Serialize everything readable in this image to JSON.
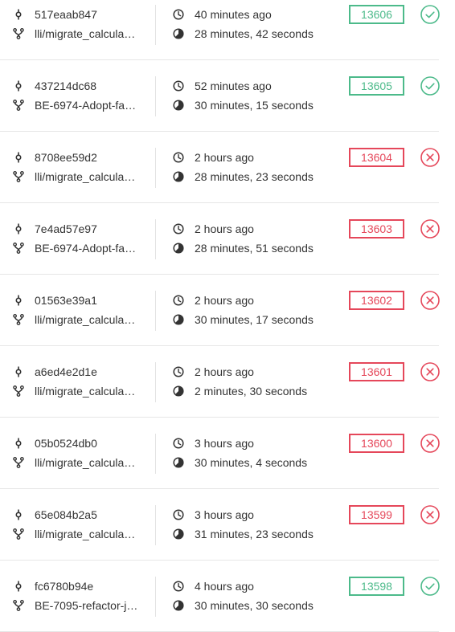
{
  "colors": {
    "success": "#4cba8a",
    "failed": "#e5475a",
    "text": "#333333",
    "divider": "#e6e6e6"
  },
  "icons": {
    "commit": "commit-icon",
    "branch": "branch-icon",
    "time": "clock-icon",
    "duration": "duration-icon",
    "success": "check-circle-icon",
    "failed": "x-circle-icon"
  },
  "builds": [
    {
      "commit": "517eaab847",
      "branch": "lli/migrate_calculat…",
      "time_ago": "40 minutes ago",
      "duration": "28 minutes, 42 seconds",
      "number": "13606",
      "status": "success"
    },
    {
      "commit": "437214dc68",
      "branch": "BE-6974-Adopt-far…",
      "time_ago": "52 minutes ago",
      "duration": "30 minutes, 15 seconds",
      "number": "13605",
      "status": "success"
    },
    {
      "commit": "8708ee59d2",
      "branch": "lli/migrate_calculat…",
      "time_ago": "2 hours ago",
      "duration": "28 minutes, 23 seconds",
      "number": "13604",
      "status": "failed"
    },
    {
      "commit": "7e4ad57e97",
      "branch": "BE-6974-Adopt-far…",
      "time_ago": "2 hours ago",
      "duration": "28 minutes, 51 seconds",
      "number": "13603",
      "status": "failed"
    },
    {
      "commit": "01563e39a1",
      "branch": "lli/migrate_calculat…",
      "time_ago": "2 hours ago",
      "duration": "30 minutes, 17 seconds",
      "number": "13602",
      "status": "failed"
    },
    {
      "commit": "a6ed4e2d1e",
      "branch": "lli/migrate_calculat…",
      "time_ago": "2 hours ago",
      "duration": "2 minutes, 30 seconds",
      "number": "13601",
      "status": "failed"
    },
    {
      "commit": "05b0524db0",
      "branch": "lli/migrate_calculat…",
      "time_ago": "3 hours ago",
      "duration": "30 minutes, 4 seconds",
      "number": "13600",
      "status": "failed"
    },
    {
      "commit": "65e084b2a5",
      "branch": "lli/migrate_calculat…",
      "time_ago": "3 hours ago",
      "duration": "31 minutes, 23 seconds",
      "number": "13599",
      "status": "failed"
    },
    {
      "commit": "fc6780b94e",
      "branch": "BE-7095-refactor-jo…",
      "time_ago": "4 hours ago",
      "duration": "30 minutes, 30 seconds",
      "number": "13598",
      "status": "success"
    }
  ]
}
